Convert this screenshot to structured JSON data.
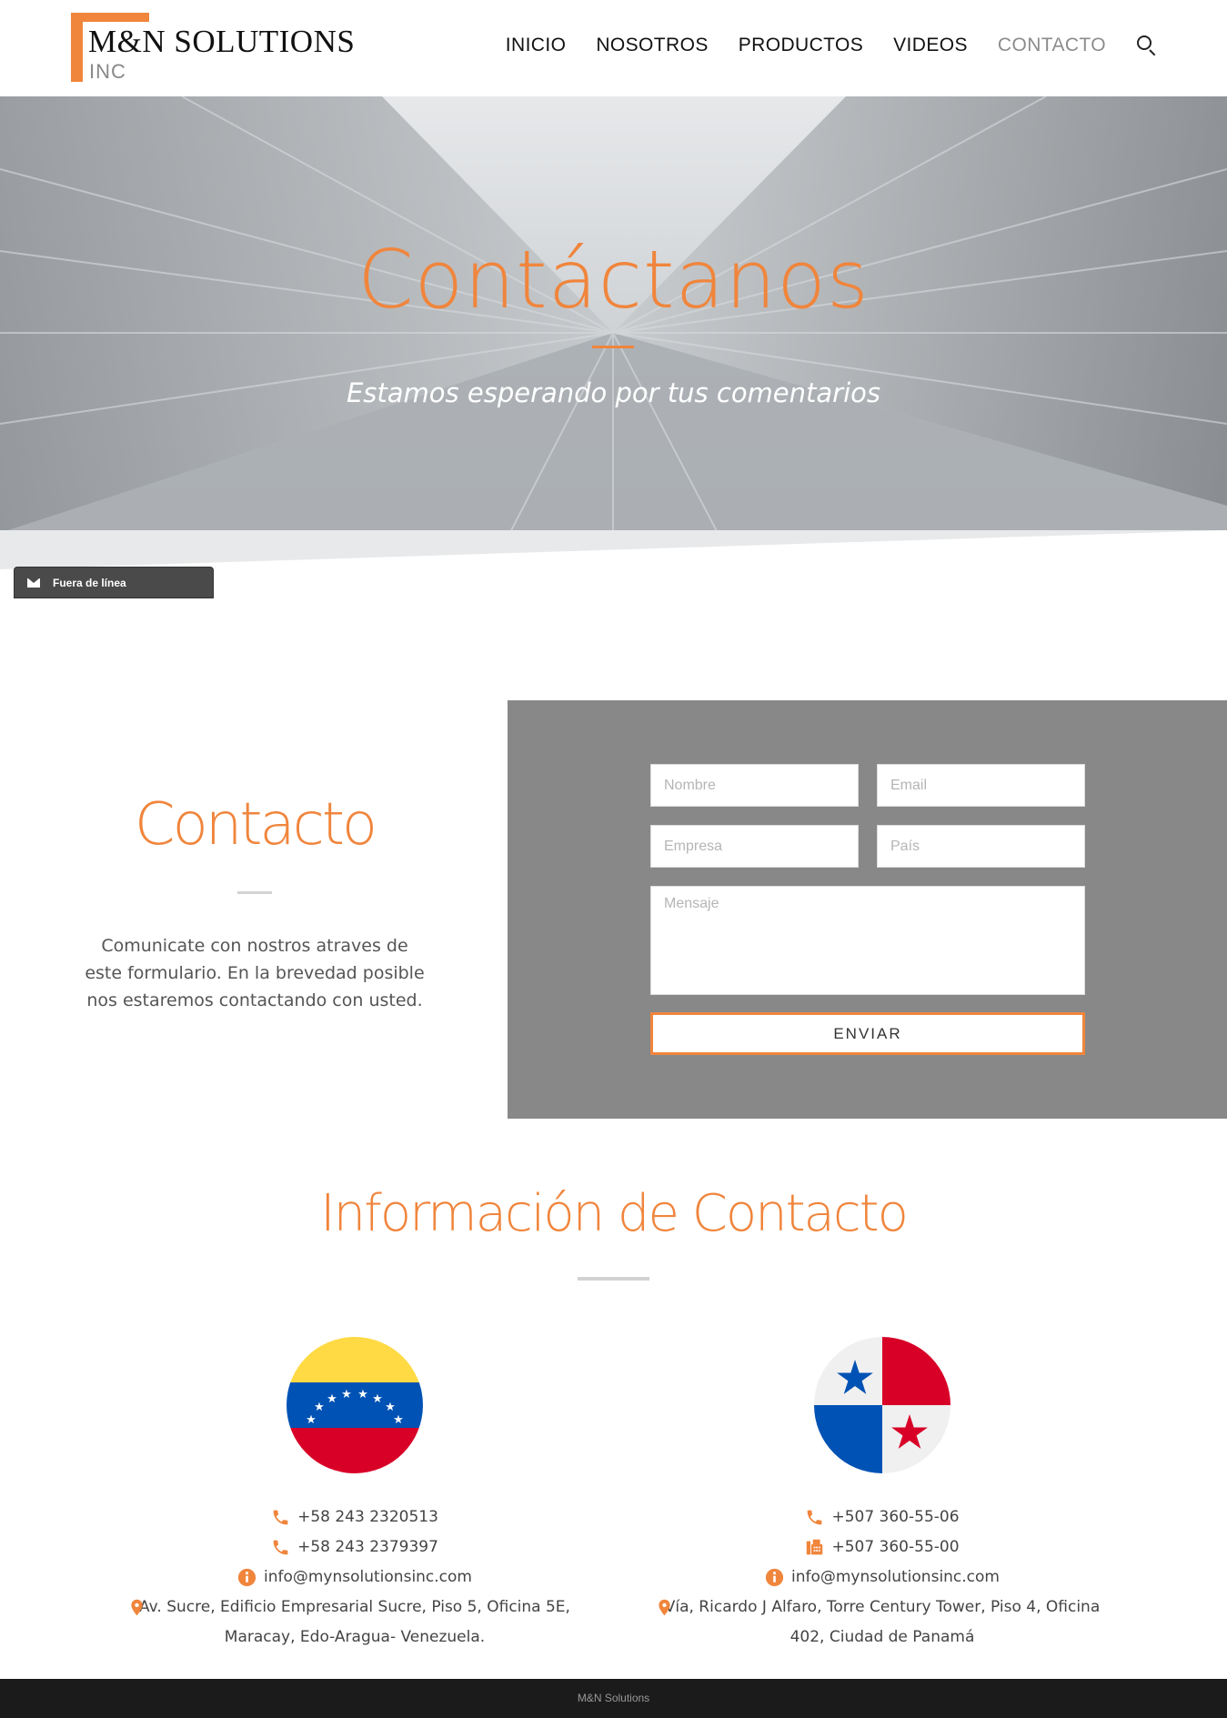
{
  "header": {
    "logo_main": "M&N SOLUTIONS",
    "logo_sub": "INC",
    "nav": [
      {
        "label": "INICIO"
      },
      {
        "label": "NOSOTROS"
      },
      {
        "label": "PRODUCTOS"
      },
      {
        "label": "VIDEOS"
      },
      {
        "label": "CONTACTO",
        "active": true
      }
    ]
  },
  "hero": {
    "title": "Contáctanos",
    "subtitle": "Estamos esperando por tus comentarios"
  },
  "chat": {
    "label": "Fuera de línea",
    "icon": "envelope-icon"
  },
  "contact": {
    "title": "Contacto",
    "description": "Comunicate con nostros atraves de este formulario. En la brevedad posible nos estaremos contactando con usted.",
    "form": {
      "nombre_placeholder": "Nombre",
      "email_placeholder": "Email",
      "empresa_placeholder": "Empresa",
      "pais_placeholder": "País",
      "mensaje_placeholder": "Mensaje",
      "submit_label": "ENVIAR"
    }
  },
  "info": {
    "title": "Información de Contacto",
    "offices": [
      {
        "flag": "venezuela-flag",
        "phone1": "+58 243 2320513",
        "phone2": "+58 243 2379397",
        "email": "info@mynsolutionsinc.com",
        "address": "Av. Sucre, Edificio Empresarial Sucre, Piso 5, Oficina 5E, Maracay, Edo-Aragua- Venezuela."
      },
      {
        "flag": "panama-flag",
        "phone1": "+507 360-55-06",
        "fax": "+507 360-55-00",
        "email": "info@mynsolutionsinc.com",
        "address": "Vía, Ricardo J Alfaro, Torre Century Tower, Piso 4, Oficina 402, Ciudad de Panamá"
      }
    ]
  },
  "footer": {
    "text": "M&N Solutions"
  },
  "colors": {
    "accent": "#f0853c",
    "form_bg": "#888888",
    "footer_bg": "#1b1b1b"
  }
}
